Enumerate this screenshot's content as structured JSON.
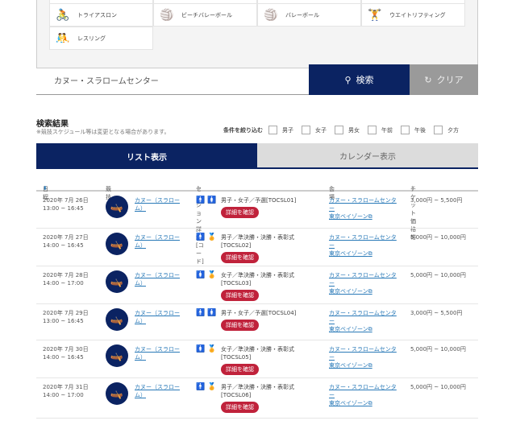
{
  "sports": [
    {
      "label": "トライアスロン",
      "icon": "triathlon-icon",
      "glyph": "🚴"
    },
    {
      "label": "ビーチバレーボール",
      "icon": "beach-volleyball-icon",
      "glyph": "🏐"
    },
    {
      "label": "バレーボール",
      "icon": "volleyball-icon",
      "glyph": "🏐"
    },
    {
      "label": "ウエイトリフティング",
      "icon": "weightlifting-icon",
      "glyph": "🏋"
    },
    {
      "label": "レスリング",
      "icon": "wrestling-icon",
      "glyph": "🤼"
    }
  ],
  "search": {
    "value": "カヌー・スラロームセンター",
    "search_label": "検索",
    "clear_label": "クリア"
  },
  "results": {
    "title": "検索結果",
    "note": "※競技スケジュール等は変更となる場合があります。",
    "filter_label": "条件を絞り込む",
    "filters": [
      "男子",
      "女子",
      "男女",
      "午前",
      "午後",
      "夕方"
    ]
  },
  "tabs": {
    "list": "リスト表示",
    "calendar": "カレンダー表示"
  },
  "columns": {
    "date": "日程",
    "event": "競技",
    "session": "セッション詳細 [コード]",
    "venue": "会場",
    "price": "チケット価格帯"
  },
  "detail_label": "詳細を確認",
  "rows": [
    {
      "date": "2020年 7月 26日",
      "time": "13:00 ~ 16:45",
      "event": "カヌー（スラローム）",
      "gender": "🚹🚺",
      "session": "男子・女子／予選[TOCSL01]",
      "venue": "カヌー・スラロームセンター",
      "area": "東京ベイゾーン",
      "price": "3,000円 ~ 5,500円"
    },
    {
      "date": "2020年 7月 27日",
      "time": "14:00 ~ 16:45",
      "event": "カヌー（スラローム）",
      "gender": "🚹🏅",
      "session": "男子／準決勝・決勝・表彰式[TOCSL02]",
      "venue": "カヌー・スラロームセンター",
      "area": "東京ベイゾーン",
      "price": "5,000円 ~ 10,000円"
    },
    {
      "date": "2020年 7月 28日",
      "time": "14:00 ~ 17:00",
      "event": "カヌー（スラローム）",
      "gender": "🚺🏅",
      "session": "女子／準決勝・決勝・表彰式[TOCSL03]",
      "venue": "カヌー・スラロームセンター",
      "area": "東京ベイゾーン",
      "price": "5,000円 ~ 10,000円"
    },
    {
      "date": "2020年 7月 29日",
      "time": "13:00 ~ 16:45",
      "event": "カヌー（スラローム）",
      "gender": "🚹🚺",
      "session": "男子・女子／予選[TOCSL04]",
      "venue": "カヌー・スラロームセンター",
      "area": "東京ベイゾーン",
      "price": "3,000円 ~ 5,500円"
    },
    {
      "date": "2020年 7月 30日",
      "time": "14:00 ~ 16:45",
      "event": "カヌー（スラローム）",
      "gender": "🚺🏅",
      "session": "女子／準決勝・決勝・表彰式[TOCSL05]",
      "venue": "カヌー・スラロームセンター",
      "area": "東京ベイゾーン",
      "price": "5,000円 ~ 10,000円"
    },
    {
      "date": "2020年 7月 31日",
      "time": "14:00 ~ 17:00",
      "event": "カヌー（スラローム）",
      "gender": "🚹🏅",
      "session": "男子／準決勝・決勝・表彰式[TOCSL06]",
      "venue": "カヌー・スラロームセンター",
      "area": "東京ベイゾーン",
      "price": "5,000円 ~ 10,000円"
    }
  ]
}
